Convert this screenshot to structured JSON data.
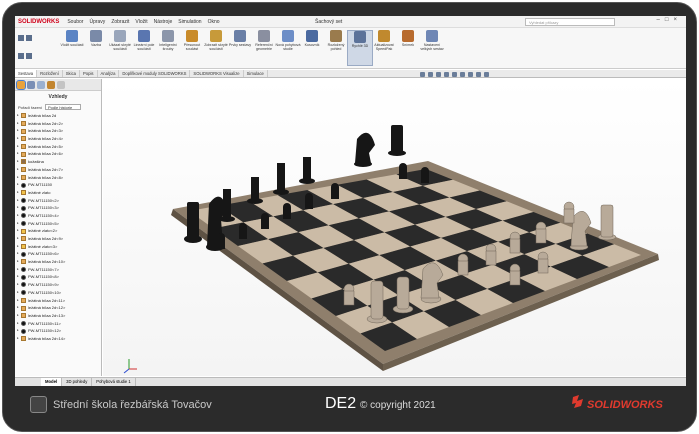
{
  "app": {
    "brand": "SOLIDWORKS",
    "doc_title": "Šachový set",
    "search_placeholder": "Vyhledat příkazy"
  },
  "menu": [
    "Soubor",
    "Úpravy",
    "Zobrazit",
    "Vložit",
    "Nástroje",
    "Simulation",
    "Okno"
  ],
  "ribbon": [
    {
      "label": "Vložit součásti",
      "color": "#5b84c4"
    },
    {
      "label": "Vazba",
      "color": "#7a8aa8"
    },
    {
      "label": "Ukázat skryté součásti",
      "color": "#9aa6bb"
    },
    {
      "label": "Lineární pole součásti",
      "color": "#5a76b0"
    },
    {
      "label": "Inteligentní šrouby",
      "color": "#8c96aa"
    },
    {
      "label": "Přesunout součást",
      "color": "#c98b2a"
    },
    {
      "label": "Zobrazit skryté součásti",
      "color": "#c79a3a"
    },
    {
      "label": "Prvky sestavy",
      "color": "#6a7fa6"
    },
    {
      "label": "Referenční geometrie",
      "color": "#8a8fa0"
    },
    {
      "label": "Nová pohybová studie",
      "color": "#6d8ec7"
    },
    {
      "label": "Kusovník",
      "color": "#4b6aa0"
    },
    {
      "label": "Rozložený pohled",
      "color": "#9a7b4d"
    },
    {
      "label": "Rychlé 3D",
      "color": "#5c7299",
      "selected": true
    },
    {
      "label": "Aktualizovat SpeedPak",
      "color": "#c0892e"
    },
    {
      "label": "Snímek",
      "color": "#b86b2e"
    },
    {
      "label": "Nastavení velkých sestav",
      "color": "#6f87b5"
    }
  ],
  "tabs": [
    "Sestava",
    "Rozložení",
    "Skica",
    "Popis",
    "Analýza",
    "Doplňkové moduly SOLIDWORKS",
    "SOLIDWORKS Visualize",
    "Simulace"
  ],
  "panel": {
    "heading": "Vzhledy",
    "sort_label": "Pořadí řazení",
    "sort_value": "Podle historie",
    "items": [
      {
        "label": "ležátná bílaa 2d",
        "kind": "orange"
      },
      {
        "label": "ležátná bílaa 2d<2>",
        "kind": "orange"
      },
      {
        "label": "ležátná bílaa 2d<3>",
        "kind": "orange"
      },
      {
        "label": "ležátná bílaa 2d<4>",
        "kind": "orange"
      },
      {
        "label": "ležátná bílaa 2d<5>",
        "kind": "orange"
      },
      {
        "label": "ležátná bílaa 2d<6>",
        "kind": "orange"
      },
      {
        "label": "kožašina",
        "kind": "wood"
      },
      {
        "label": "ležátná bílaa 2d<7>",
        "kind": "orange"
      },
      {
        "label": "ležátná bílaa 2d<8>",
        "kind": "orange"
      },
      {
        "label": "PW-MT11150",
        "kind": "dark"
      },
      {
        "label": "ležátné zlato",
        "kind": "folder"
      },
      {
        "label": "PW-MT11150<2>",
        "kind": "dark"
      },
      {
        "label": "PW-MT11150<3>",
        "kind": "dark"
      },
      {
        "label": "PW-MT11150<4>",
        "kind": "dark"
      },
      {
        "label": "PW-MT11150<5>",
        "kind": "dark"
      },
      {
        "label": "ležátné zlato<2>",
        "kind": "folder"
      },
      {
        "label": "ležátná bílaa 2d<9>",
        "kind": "orange"
      },
      {
        "label": "ležátné zlato<3>",
        "kind": "folder"
      },
      {
        "label": "PW-MT11150<6>",
        "kind": "dark"
      },
      {
        "label": "ležátná bílaa 2d<10>",
        "kind": "orange"
      },
      {
        "label": "PW-MT11150<7>",
        "kind": "dark"
      },
      {
        "label": "PW-MT11150<8>",
        "kind": "dark"
      },
      {
        "label": "PW-MT11150<9>",
        "kind": "dark"
      },
      {
        "label": "PW-MT11150<10>",
        "kind": "dark"
      },
      {
        "label": "ležátná bílaa 2d<11>",
        "kind": "orange"
      },
      {
        "label": "ležátná bílaa 2d<12>",
        "kind": "orange"
      },
      {
        "label": "ležátná bílaa 2d<13>",
        "kind": "orange"
      },
      {
        "label": "PW-MT11150<11>",
        "kind": "dark"
      },
      {
        "label": "PW-MT11150<12>",
        "kind": "dark"
      },
      {
        "label": "ležátná bílaa 2d<14>",
        "kind": "orange"
      }
    ]
  },
  "bottom_tabs": [
    "Model",
    "3D pohledy",
    "Pohybová studie 1"
  ],
  "footer": {
    "school": "Střední škola řezbářská Tovačov",
    "title": "DE2",
    "copyright": "© copyright 2021",
    "logo": "SOLIDWORKS"
  },
  "colors": {
    "brand_red": "#d0021b",
    "dark_square": "#2a2a2a",
    "light_square": "#cbbba6",
    "frame": "#8f7f6c"
  }
}
